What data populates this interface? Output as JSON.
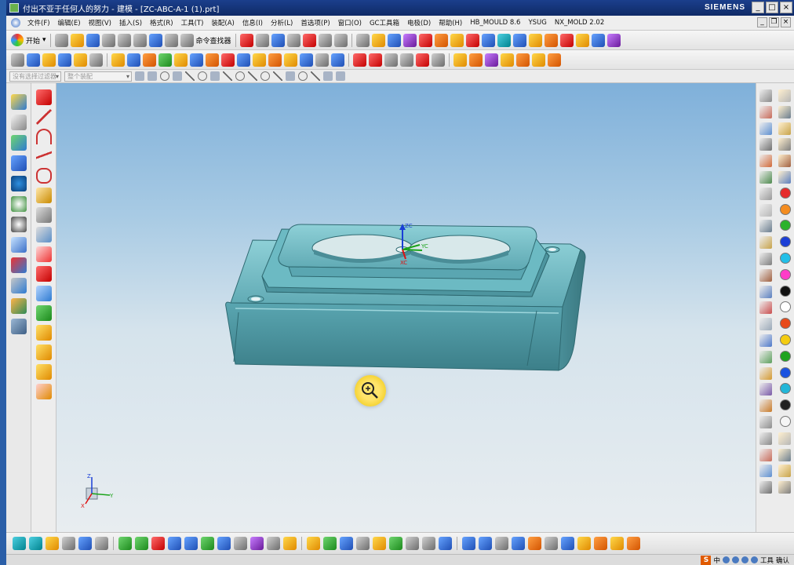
{
  "window": {
    "title": "付出不亚于任何人的努力 - 建模 - [ZC-ABC-A-1 (1).prt]",
    "brand": "SIEMENS",
    "minimize": "_",
    "maximize": "□",
    "close": "×"
  },
  "menubar": {
    "items": [
      "文件(F)",
      "编辑(E)",
      "视图(V)",
      "插入(S)",
      "格式(R)",
      "工具(T)",
      "装配(A)",
      "信息(I)",
      "分析(L)",
      "首选项(P)",
      "窗口(O)",
      "GC工具箱",
      "电极(D)",
      "帮助(H)",
      "HB_MOULD 8.6",
      "YSUG",
      "NX_MOLD 2.02"
    ],
    "inner_min": "_",
    "inner_restore": "❐",
    "inner_close": "×"
  },
  "toolbar1": {
    "start_label": "开始",
    "command_finder_label": "命令查找器",
    "icon_names": [
      "new-file-icon",
      "open-folder-icon",
      "save-icon",
      "cut-icon",
      "copy-icon",
      "paste-icon",
      "undo-icon",
      "redo-icon"
    ]
  },
  "selection_bar": {
    "filter_placeholder": "没有选择过滤器",
    "scope_placeholder": "整个装配"
  },
  "viewport": {
    "csys_labels": {
      "z": "ZC",
      "x": "XC",
      "y": "YC"
    },
    "triad_labels": {
      "z": "Z",
      "x": "X",
      "y": "Y"
    }
  },
  "tray": {
    "ime_label": "S",
    "ime_mode": "中",
    "tools_label": "工具",
    "confirm_label": "确认"
  },
  "colors": {
    "title_bar": "#1b3f8c",
    "viewport_top": "#7fb0da",
    "viewport_bottom": "#e8edf0",
    "part_body": "#4f9aa6",
    "part_top": "#79c3cc",
    "zoom_cursor": "#f1d11b"
  },
  "right_palette_colors": [
    "#e52b2b",
    "#f48c1f",
    "#2bb22b",
    "#1c3fd6",
    "#22bfe8",
    "#ff3cc8",
    "#111111",
    "#ffffff",
    "#e84a1a",
    "#f4cc10",
    "#1fa31f",
    "#1a52e0",
    "#22b6d8",
    "#222222",
    "#f5f5f5"
  ]
}
